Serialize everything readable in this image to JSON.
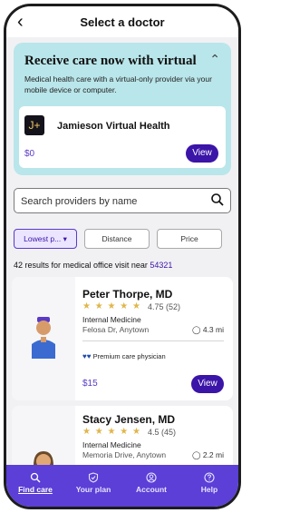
{
  "header": {
    "title": "Select a doctor"
  },
  "promo": {
    "heading": "Receive care now with virtual",
    "description": "Medical health care with a virtual-only provider via your mobile device or computer.",
    "provider": {
      "logo_text": "J+",
      "name": "Jamieson Virtual Health",
      "price": "$0",
      "view_label": "View"
    }
  },
  "search": {
    "placeholder": "Search providers by name",
    "value": ""
  },
  "filters": [
    {
      "label": "Lowest p... ▾",
      "selected": true
    },
    {
      "label": "Distance",
      "selected": false
    },
    {
      "label": "Price",
      "selected": false
    }
  ],
  "results": {
    "text": "42 results for medical office visit near ",
    "zip": "54321"
  },
  "doctors": [
    {
      "name": "Peter Thorpe, MD",
      "stars": "★ ★ ★ ★ ★",
      "rating_text": "4.75 (52)",
      "rating": 4.75,
      "specialty": "Internal Medicine",
      "address": "Felosa Dr, Anytown",
      "distance": "4.3 mi",
      "premium_label": "Premium care physician",
      "price": "$15",
      "view_label": "View"
    },
    {
      "name": "Stacy Jensen, MD",
      "stars": "★ ★ ★ ★ ★",
      "rating_text": "4.5 (45)",
      "rating": 4.5,
      "specialty": "Internal Medicine",
      "address": "Memoria Drive, Anytown",
      "distance": "2.2 mi"
    }
  ],
  "nav": [
    {
      "label": "Find care",
      "icon": "search-icon",
      "active": true
    },
    {
      "label": "Your plan",
      "icon": "shield-icon",
      "active": false
    },
    {
      "label": "Account",
      "icon": "account-icon",
      "active": false
    },
    {
      "label": "Help",
      "icon": "help-icon",
      "active": false
    }
  ],
  "colors": {
    "accent": "#3b14a8",
    "nav_bg": "#5b3fd6",
    "promo_bg": "#b9e6ea"
  }
}
